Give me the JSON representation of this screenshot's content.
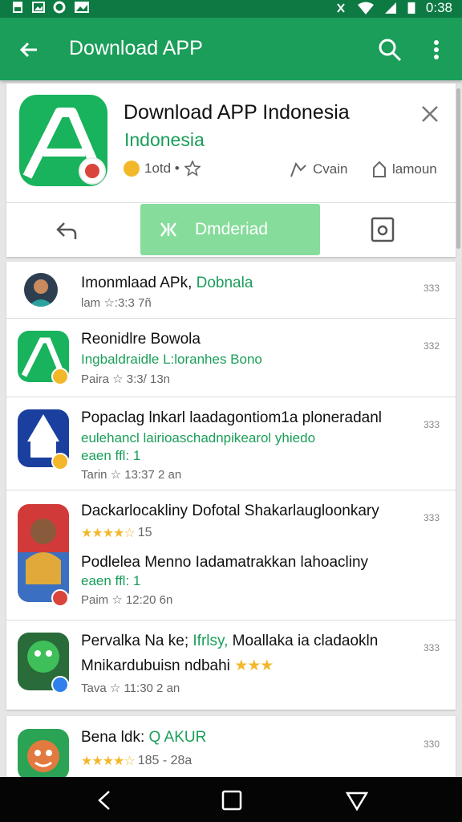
{
  "status_bar": {
    "time": "0:38"
  },
  "app_bar": {
    "title": "Download APP"
  },
  "header": {
    "app_name": "Download APP Indonesia",
    "subtitle": "Indonesia",
    "rating_text": "1otd •",
    "meta_middle": "Cvain",
    "meta_right": "lamoun",
    "install_label": "Dmderiad"
  },
  "list": [
    {
      "title": "Imonmlaad APk,",
      "title_green": "Dobnala",
      "sub": "",
      "meta": "lam ☆:3:3 7ñ",
      "num": "333"
    },
    {
      "title": "Reonidlre Bowola",
      "title_green": "",
      "sub": "Ingbaldraidle L:loranhes Bono",
      "meta": "Paira ☆ 3:3/ 13n",
      "num": "332"
    },
    {
      "title": "Popaclag lnkarl laadagontiom1a ploneradanl",
      "title_green": "",
      "sub": "eulehancl lairioaschadnpikearol yhiedo",
      "sub2": "eaen ffl: 1",
      "meta": "Tarin ☆ 13:37 2 an",
      "num": "333"
    },
    {
      "title": "Dackarlocakliny Dofotal Shakarlaugloonkary",
      "title_green": "",
      "stars": "★★★★☆",
      "rating": "15",
      "title2": "Podlelea Menno Iadamatrakkan lahoacliny",
      "sub2": "eaen ffl: 1",
      "meta": "Paim ☆ 12:20 6n",
      "num": "333"
    },
    {
      "title": "Pervalka Na ke;",
      "title_mid": "Ifrlsy,",
      "title_tail": "Moallaka ia cladaokln",
      "sub": "Mnikardubuisn ndbahi",
      "sub_stars": "★★★",
      "meta": "Tava ☆ 11:30 2 an",
      "num": "333"
    },
    {
      "title": "Bena ldk:",
      "title_green": "Q AKUR",
      "stars": "★★★★☆",
      "rating": "185 - 28a",
      "num": "330"
    }
  ]
}
